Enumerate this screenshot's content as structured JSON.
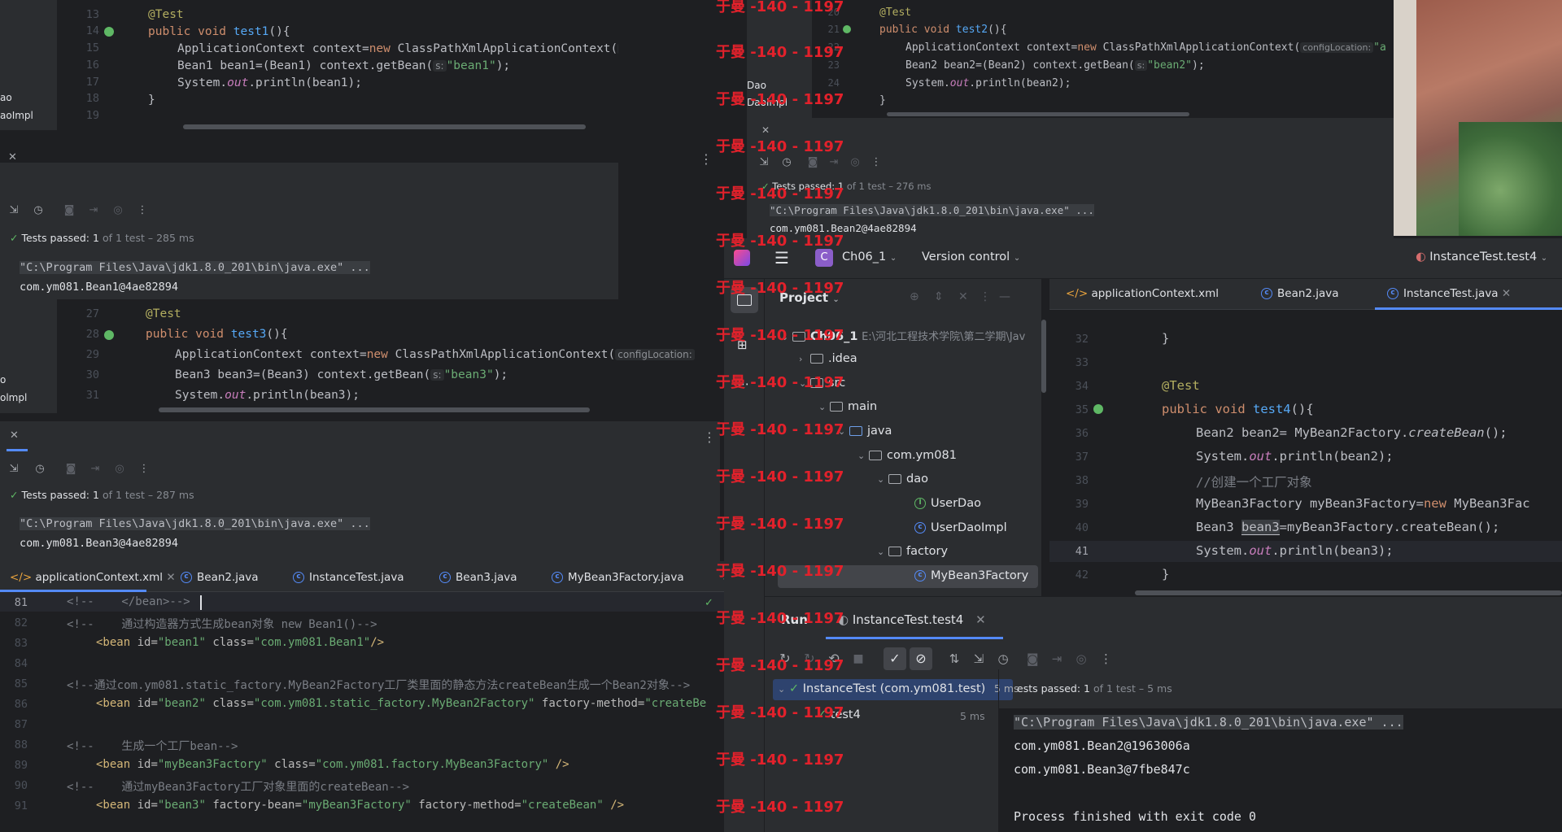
{
  "watermark": "于曼 -140 - 1197",
  "pane1": {
    "lines": [
      "13",
      "14",
      "15",
      "16",
      "17",
      "18",
      "19"
    ],
    "annotation": "@Test",
    "method": "test1",
    "new_ctx": "ApplicationContext context=",
    "new_kw": "new",
    "ctx_class": " ClassPathXmlApplicationContext(",
    "hint": "configLocation:",
    "bean_decl": "Bean1 bean1=(Bean1) context.getBean(",
    "s_hint": "s:",
    "bean_str": "\"bean1\"",
    "tail": ");",
    "println_pre": "System.",
    "println_out": "out",
    "println_post": ".println(bean1);",
    "close": "}",
    "sidebar_1": "ao",
    "sidebar_2": "aoImpl",
    "passed_label": "Tests passed:",
    "passed_count": "1",
    "passed_rest": "of 1 test – 285 ms",
    "cmd": "\"C:\\Program Files\\Java\\jdk1.8.0_201\\bin\\java.exe\" ...",
    "result": "com.ym081.Bean1@4ae82894"
  },
  "pane2": {
    "lines": [
      "20",
      "21",
      "22",
      "23",
      "24"
    ],
    "annotation": "@Test",
    "method": "test2",
    "new_ctx": "ApplicationContext context=",
    "new_kw": "new",
    "ctx_class": " ClassPathXmlApplicationContext(",
    "hint": "configLocation:",
    "bean_decl": "Bean2 bean2=(Bean2) context.getBean(",
    "s_hint": "s:",
    "bean_str": "\"bean2\"",
    "tail": ");",
    "println_post": ".println(bean2);",
    "sidebar_1": "Dao",
    "sidebar_2": "DaoImpl",
    "passed_label": "Tests passed:",
    "passed_count": "1",
    "passed_rest": "of 1 test – 276 ms",
    "cmd": "\"C:\\Program Files\\Java\\jdk1.8.0_201\\bin\\java.exe\" ...",
    "result": "com.ym081.Bean2@4ae82894"
  },
  "pane3": {
    "lines": [
      "27",
      "28",
      "29",
      "30",
      "31"
    ],
    "annotation": "@Test",
    "method": "test3",
    "bean_decl": "Bean3 bean3=(Bean3) context.getBean(",
    "bean_str": "\"bean3\"",
    "println_post": ".println(bean3);",
    "sidebar_1": "o",
    "sidebar_2": "olmpl",
    "passed_label": "Tests passed:",
    "passed_count": "1",
    "passed_rest": "of 1 test – 287 ms",
    "cmd": "\"C:\\Program Files\\Java\\jdk1.8.0_201\\bin\\java.exe\" ...",
    "result": "com.ym081.Bean3@4ae82894"
  },
  "xml": {
    "tabs": [
      "applicationContext.xml",
      "Bean2.java",
      "InstanceTest.java",
      "Bean3.java",
      "MyBean3Factory.java"
    ],
    "lines": [
      "81",
      "82",
      "83",
      "84",
      "85",
      "86",
      "87",
      "88",
      "89",
      "90",
      "91"
    ],
    "l81": "<!--    </bean>-->",
    "l82": "<!--    通过构造器方式生成bean对象 new Bean1()-->",
    "l83a": "<bean",
    "l83b": " id=",
    "l83c": "\"bean1\"",
    "l83d": " class=",
    "l83e": "\"com.ym081.Bean1\"",
    "l83f": "/>",
    "l85": "<!--通过com.ym081.static_factory.MyBean2Factory工厂类里面的静态方法createBean生成一个Bean2对象-->",
    "l86c": "\"bean2\"",
    "l86e": "\"com.ym081.static_factory.MyBean2Factory\"",
    "l86g": " factory-method=",
    "l86h": "\"createBe",
    "l88": "<!--    生成一个工厂bean-->",
    "l89c": "\"myBean3Factory\"",
    "l89e": "\"com.ym081.factory.MyBean3Factory\"",
    "l89f": " />",
    "l90": "<!--    通过myBean3Factory工厂对象里面的createBean-->",
    "l91b": " factory-bean=",
    "l91c": "\"myBean3Factory\"",
    "l91h": "\"createBean\"",
    "l91bid": "\"bean3\""
  },
  "ide": {
    "project_name": "Ch06_1",
    "project_badge": "C",
    "vcs": "Version control",
    "run_config": "InstanceTest.test4",
    "project_label": "Project",
    "tree": {
      "root": "Ch06_1",
      "root_path": "E:\\河北工程技术学院\\第二学期\\Jav",
      "idea": ".idea",
      "src": "src",
      "main": "main",
      "java": "java",
      "pkg": "com.ym081",
      "dao": "dao",
      "userdao": "UserDao",
      "userdaoimpl": "UserDaoImpl",
      "factory": "factory",
      "mybean3factory": "MyBean3Factory"
    },
    "tabs": [
      "applicationContext.xml",
      "Bean2.java",
      "InstanceTest.java"
    ],
    "lines": [
      "32",
      "33",
      "34",
      "35",
      "36",
      "37",
      "38",
      "39",
      "40",
      "41",
      "42"
    ],
    "annotation": "@Test",
    "method": "test4",
    "l36a": "Bean2 bean2= MyBean2Factory.",
    "l36b": "createBean",
    "l36c": "();",
    "l37": ".println(bean2);",
    "l38": "//创建一个工厂对象",
    "l39a": "MyBean3Factory myBean3Factory=",
    "l39b": "new",
    "l39c": " MyBean3Fac",
    "l40a": "Bean3 ",
    "l40b": "bean3",
    "l40c": "=myBean3Factory.createBean();",
    "l41": ".println(bean3);",
    "run_label": "Run",
    "run_tab": "InstanceTest.test4",
    "test_root": "InstanceTest (com.ym081.test)",
    "test_root_time": "5 ms",
    "test_child": "test4",
    "test_child_time": "5 ms",
    "passed_label": "ests passed:",
    "passed_count": "1",
    "passed_rest": "of 1 test – 5 ms",
    "cmd": "\"C:\\Program Files\\Java\\jdk1.8.0_201\\bin\\java.exe\" ...",
    "out1": "com.ym081.Bean2@1963006a",
    "out2": "com.ym081.Bean3@7fbe847c",
    "exit": "Process finished with exit code 0"
  }
}
